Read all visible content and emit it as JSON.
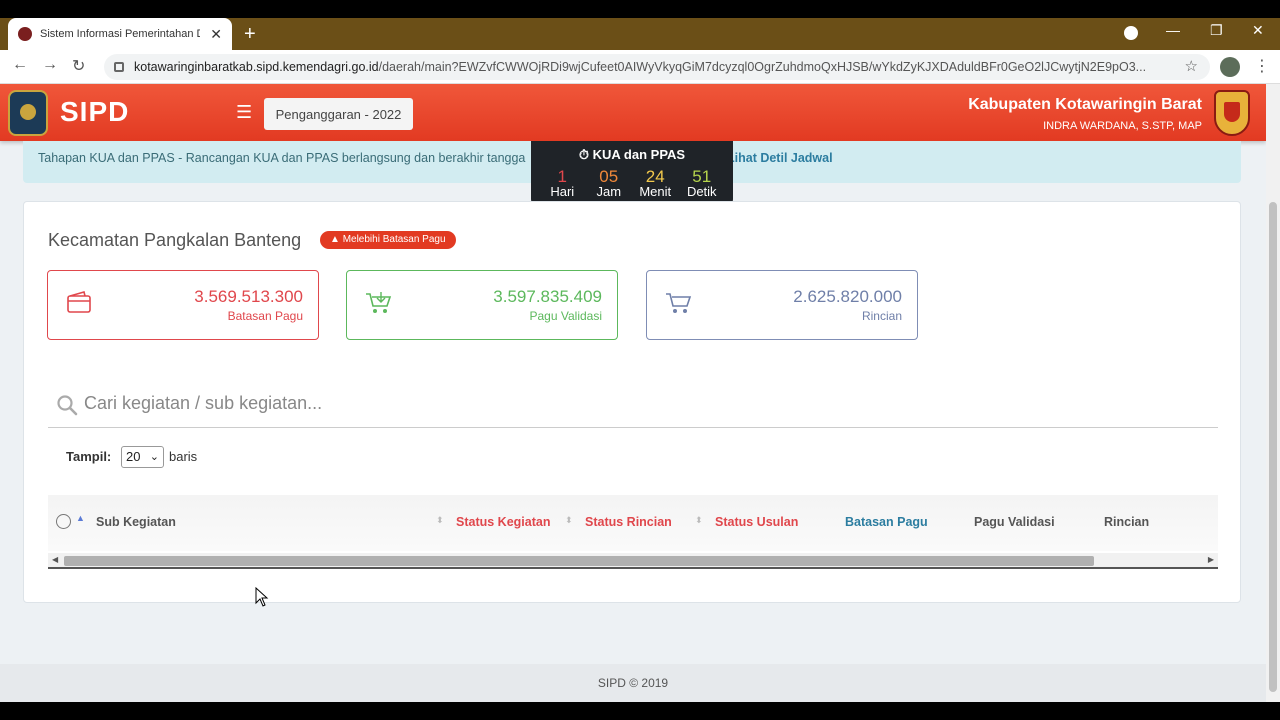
{
  "browser": {
    "tab_title": "Sistem Informasi Pemerintahan D",
    "url_host": "kotawaringinbaratkab.sipd.kemendagri.go.id",
    "url_path": "/daerah/main?EWZvfCWWOjRDi9wjCufeet0AIWyVkyqGiM7dcyzql0OgrZuhdmoQxHJSB/wYkdZyKJXDAduldBFr0GeO2lJCwytjN2E9pO3..."
  },
  "header": {
    "brand": "SIPD",
    "year_select": "Penganggaran - 2022",
    "region": "Kabupaten Kotawaringin Barat",
    "user": "INDRA WARDANA, S.STP, MAP"
  },
  "info": {
    "text": "Tahapan KUA dan PPAS - Rancangan KUA dan PPAS berlangsung dan berakhir tangga",
    "link": "Lihat Detil Jadwal"
  },
  "countdown": {
    "title": "KUA dan PPAS",
    "days": "1",
    "days_label": "Hari",
    "hours": "05",
    "hours_label": "Jam",
    "minutes": "24",
    "minutes_label": "Menit",
    "seconds": "51",
    "seconds_label": "Detik"
  },
  "kecamatan": {
    "title": "Kecamatan Pangkalan Banteng",
    "warning": "Melebihi Batasan Pagu"
  },
  "stats": [
    {
      "value": "3.569.513.300",
      "label": "Batasan Pagu",
      "color": "#e0474c"
    },
    {
      "value": "3.597.835.409",
      "label": "Pagu Validasi",
      "color": "#5cb85c"
    },
    {
      "value": "2.625.820.000",
      "label": "Rincian",
      "color": "#6f7fa8"
    }
  ],
  "search": {
    "placeholder": "Cari kegiatan / sub kegiatan..."
  },
  "paging": {
    "tampil_label": "Tampil:",
    "value": "20",
    "baris_label": "baris"
  },
  "table": {
    "columns": [
      "Sub Kegiatan",
      "Status Kegiatan",
      "Status Rincian",
      "Status Usulan",
      "Batasan Pagu",
      "Pagu Validasi",
      "Rincian"
    ]
  },
  "footer": {
    "text": "SIPD © 2019"
  }
}
